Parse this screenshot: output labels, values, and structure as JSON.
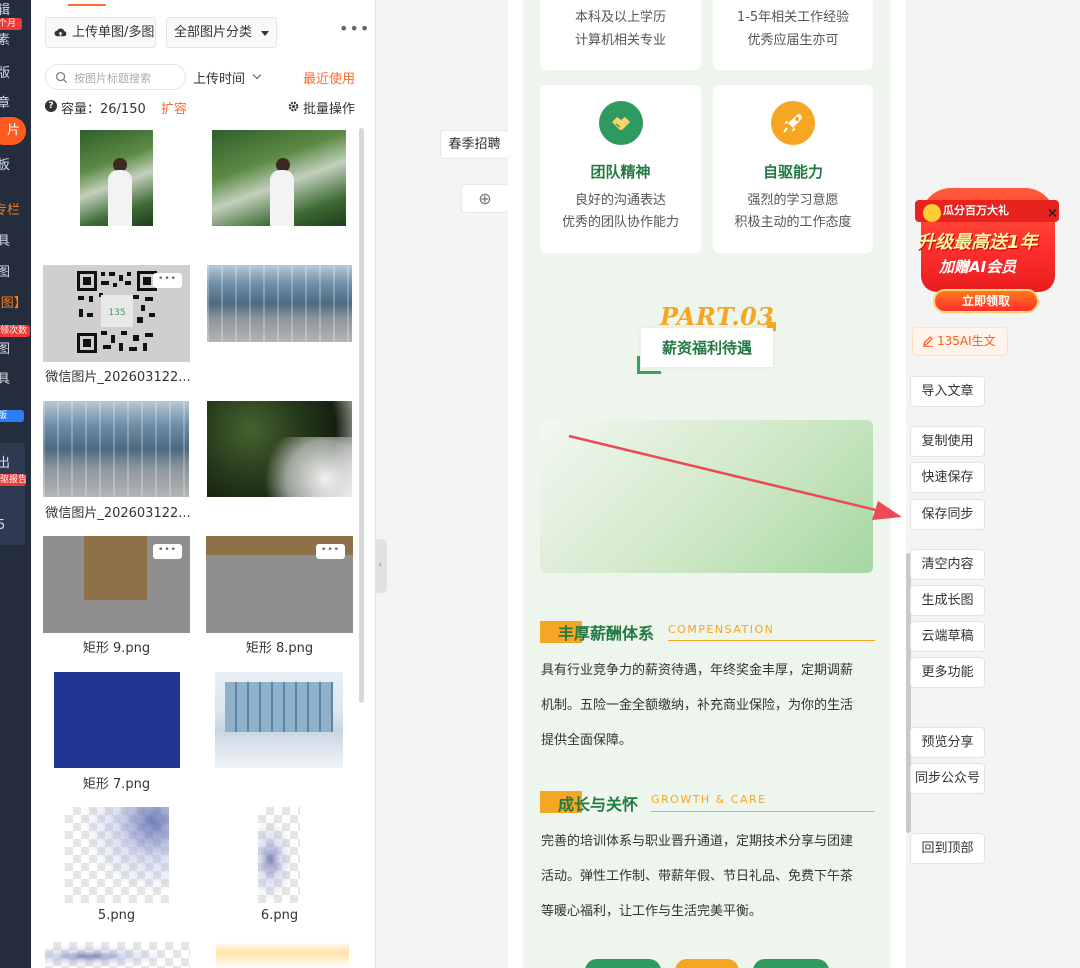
{
  "left_nav": {
    "items": [
      "辑",
      "素",
      "版",
      "章",
      "片",
      "板",
      "专栏",
      "具",
      "图",
      "AI图】",
      "图",
      "具",
      "出",
      "5"
    ],
    "active_item": "片",
    "badges": [
      "个月",
      "领次数",
      "版",
      "驱报告"
    ]
  },
  "image_panel": {
    "upload_label": "上传单图/多图",
    "category_label": "全部图片分类",
    "more_label": "•••",
    "search_placeholder": "按图片标题搜索",
    "sort_label": "上传时间",
    "recent_label": "最近使用",
    "capacity_label": "容量：26/150",
    "expand_label": "扩容",
    "batch_label": "批量操作",
    "dots_label": "•••",
    "images": [
      {
        "caption": ""
      },
      {
        "caption": ""
      },
      {
        "caption": "微信图片_202603122..."
      },
      {
        "caption": ""
      },
      {
        "caption": "微信图片_202603122..."
      },
      {
        "caption": ""
      },
      {
        "caption": "矩形 9.png"
      },
      {
        "caption": "矩形 8.png"
      },
      {
        "caption": "矩形 7.png"
      },
      {
        "caption": ""
      },
      {
        "caption": "5.png"
      },
      {
        "caption": "6.png"
      }
    ],
    "qr_text": "135"
  },
  "editor": {
    "float_label": "春季招聘",
    "add_symbol": "⊕"
  },
  "article": {
    "cards_top": [
      {
        "line1": "本科及以上学历",
        "line2": "计算机相关专业"
      },
      {
        "line1": "1-5年相关工作经验",
        "line2": "优秀应届生亦可"
      }
    ],
    "cards": [
      {
        "title": "团队精神",
        "line1": "良好的沟通表达",
        "line2": "优秀的团队协作能力",
        "icon": "handshake-icon",
        "color": "#2e9a5f"
      },
      {
        "title": "自驱能力",
        "line1": "强烈的学习意愿",
        "line2": "积极主动的工作态度",
        "icon": "rocket-icon",
        "color": "#f5a623"
      }
    ],
    "part_label": "PART.03",
    "part_title": "薪资福利待遇",
    "sections": [
      {
        "title": "丰厚薪酬体系",
        "en": "COMPENSATION",
        "lines": [
          "具有行业竞争力的薪资待遇，年终奖金丰厚，定期调薪",
          "机制。五险一金全额缴纳，补充商业保险，为你的生活",
          "提供全面保障。"
        ]
      },
      {
        "title": "成长与关怀",
        "en": "GROWTH & CARE",
        "lines": [
          "完善的培训体系与职业晋升通道，定期技术分享与团建",
          "活动。弹性工作制、带薪年假、节日礼品、免费下午茶",
          "等暖心福利，让工作与生活完美平衡。"
        ]
      }
    ],
    "accent": "#f5a623",
    "green": "#237a43"
  },
  "promo": {
    "line1": "瓜分百万大礼",
    "line2": "升级最高送1年",
    "line3": "加赠AI会员",
    "cta": "立即领取",
    "close": "×"
  },
  "right_toolbar": {
    "ai_label": "135AI生文",
    "buttons": [
      "导入文章",
      "复制使用",
      "快速保存",
      "保存同步",
      "清空内容",
      "生成长图",
      "云端草稿",
      "更多功能",
      "预览分享",
      "同步公众号",
      "回到顶部"
    ]
  }
}
